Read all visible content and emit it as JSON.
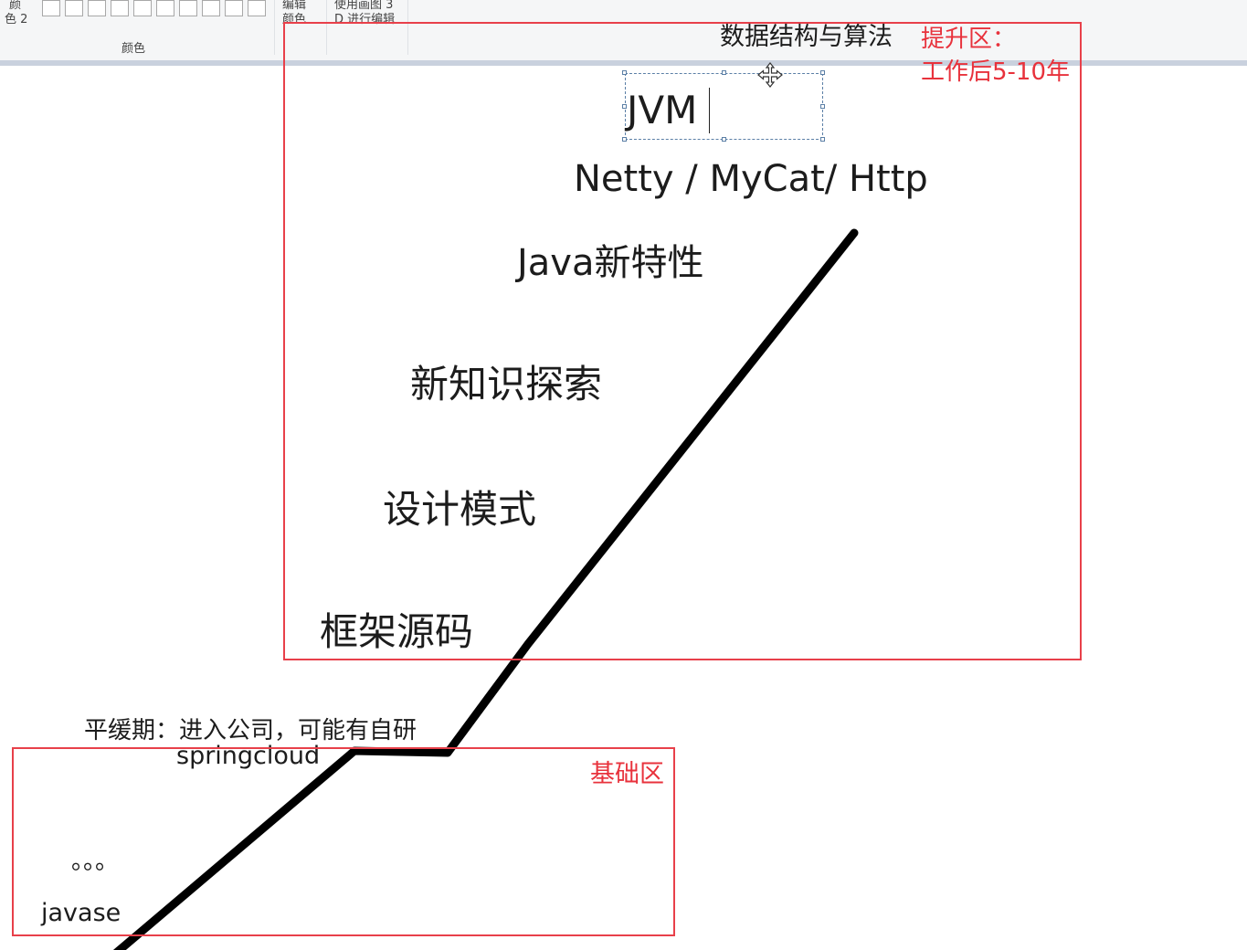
{
  "ribbon": {
    "color2_label_top": "颜",
    "color2_label": "色 2",
    "edit_colors_top": "编辑",
    "edit_colors": "颜色",
    "paint3d_top": "使用画图 3",
    "paint3d": "D 进行编辑",
    "colors_group_label": "颜色"
  },
  "canvas": {
    "upper_zone": {
      "label_line1": "提升区：",
      "label_line2": "工作后5-10年",
      "items": {
        "dsa": "数据结构与算法",
        "jvm": "JVM",
        "netty": "Netty / MyCat/ Http",
        "java_new": "Java新特性",
        "new_knowledge": "新知识探索",
        "design_patterns": "设计模式",
        "framework_source": "框架源码"
      }
    },
    "plateau": {
      "label": "平缓期：进入公司，可能有自研",
      "springcloud": "springcloud"
    },
    "base_zone": {
      "label": "基础区",
      "ellipsis": "。。。",
      "javase": "javase"
    }
  },
  "colors": {
    "box_border": "#e8404a",
    "box_label": "#e8323c",
    "stroke": "#000000"
  }
}
